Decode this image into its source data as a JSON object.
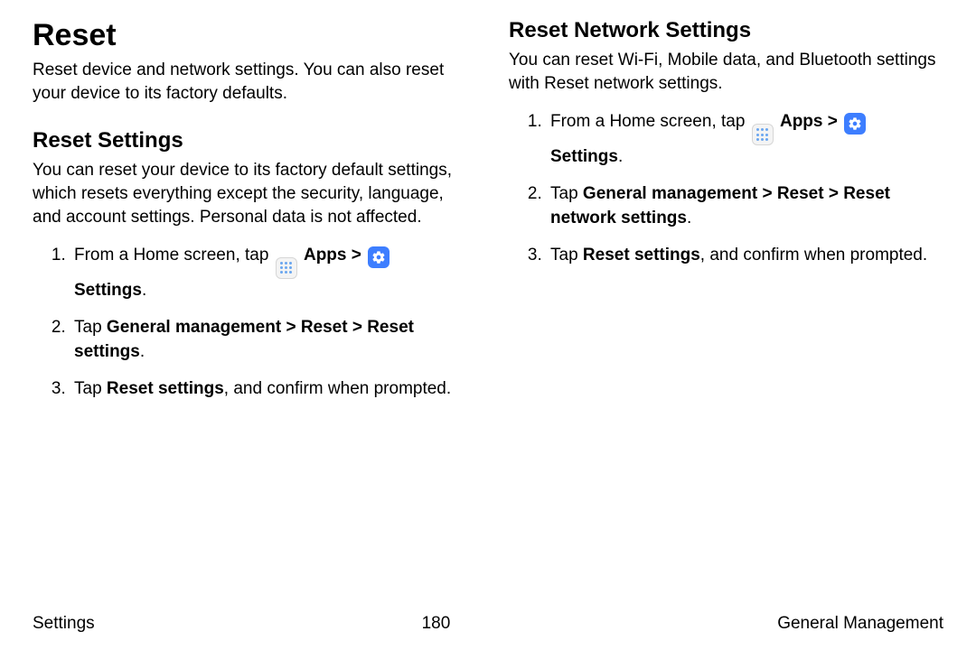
{
  "left": {
    "title": "Reset",
    "intro": "Reset device and network settings. You can also reset your device to its factory defaults.",
    "sub_heading": "Reset Settings",
    "sub_intro": "You can reset your device to its factory default settings, which resets everything except the security, language, and account settings. Personal data is not affected.",
    "step1_prefix": "From a Home screen, tap ",
    "step1_apps": "Apps",
    "step1_chev": " > ",
    "step1_settings": "Settings",
    "step1_suffix": ".",
    "step2_prefix": "Tap ",
    "step2_bold": "General management > Reset > Reset settings",
    "step2_suffix": ".",
    "step3_prefix": "Tap ",
    "step3_bold": "Reset settings",
    "step3_suffix": ", and confirm when prompted."
  },
  "right": {
    "sub_heading": "Reset Network Settings",
    "sub_intro": "You can reset Wi-Fi, Mobile data, and Bluetooth settings with Reset network settings.",
    "step1_prefix": "From a Home screen, tap ",
    "step1_apps": "Apps",
    "step1_chev": " > ",
    "step1_settings": "Settings",
    "step1_suffix": ".",
    "step2_prefix": "Tap ",
    "step2_bold": "General management > Reset > Reset network settings",
    "step2_suffix": ".",
    "step3_prefix": "Tap ",
    "step3_bold": "Reset settings",
    "step3_suffix": ", and confirm when prompted."
  },
  "footer": {
    "left": "Settings",
    "center": "180",
    "right": "General Management"
  }
}
